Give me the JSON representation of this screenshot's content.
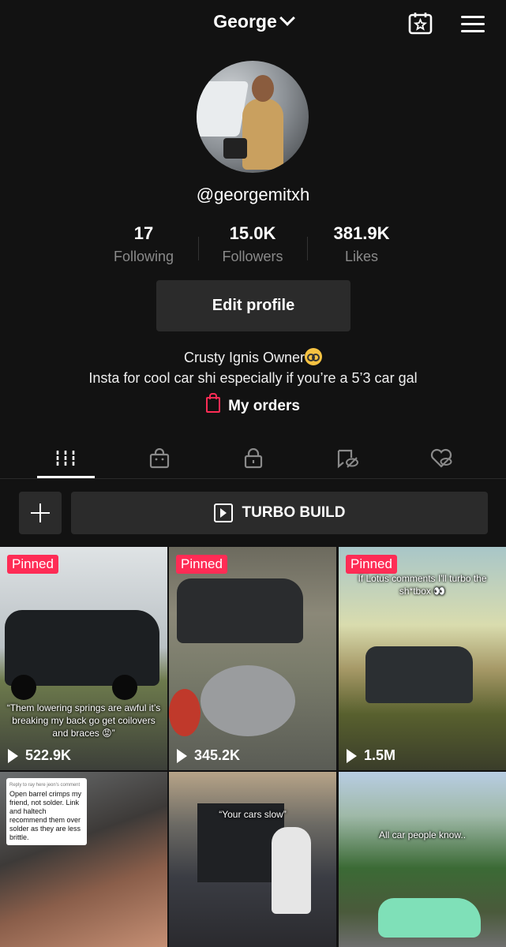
{
  "header": {
    "title": "George",
    "notification_dot_color": "#fe2c55"
  },
  "profile": {
    "username": "@georgemitxh",
    "stats": [
      {
        "value": "17",
        "label": "Following"
      },
      {
        "value": "15.0K",
        "label": "Followers"
      },
      {
        "value": "381.9K",
        "label": "Likes"
      }
    ],
    "edit_button": "Edit profile",
    "bio_line1": "Crusty Ignis Owner",
    "bio_line2": "Insta for cool car shi especially if you’re a 5’3 car gal",
    "orders_label": "My orders"
  },
  "tabs": [
    {
      "icon": "grid-icon",
      "active": true
    },
    {
      "icon": "shopping-bag-icon"
    },
    {
      "icon": "lock-icon"
    },
    {
      "icon": "tag-hidden-icon"
    },
    {
      "icon": "heart-hidden-icon"
    }
  ],
  "actions": {
    "turbo_label": "TURBO BUILD"
  },
  "videos": [
    {
      "pinned": "Pinned",
      "views": "522.9K",
      "caption": "“Them lowering springs are awful it’s breaking my back go get coilovers and braces 😡”"
    },
    {
      "pinned": "Pinned",
      "views": "345.2K",
      "caption": ""
    },
    {
      "pinned": "Pinned",
      "views": "1.5M",
      "caption": "If Lotus comments I'll turbo the sh*tbox 👀"
    },
    {
      "comment_header": "Reply to ray here jeon's comment",
      "comment_text": "Open barrel crimps my friend, not solder. Link and haltech recommend them over solder as they are less brittle."
    },
    {
      "caption": "“Your cars slow”"
    },
    {
      "caption": "All car people know.."
    }
  ],
  "colors": {
    "accent": "#fe2c55",
    "background": "#121212",
    "button_bg": "#2b2b2b"
  }
}
